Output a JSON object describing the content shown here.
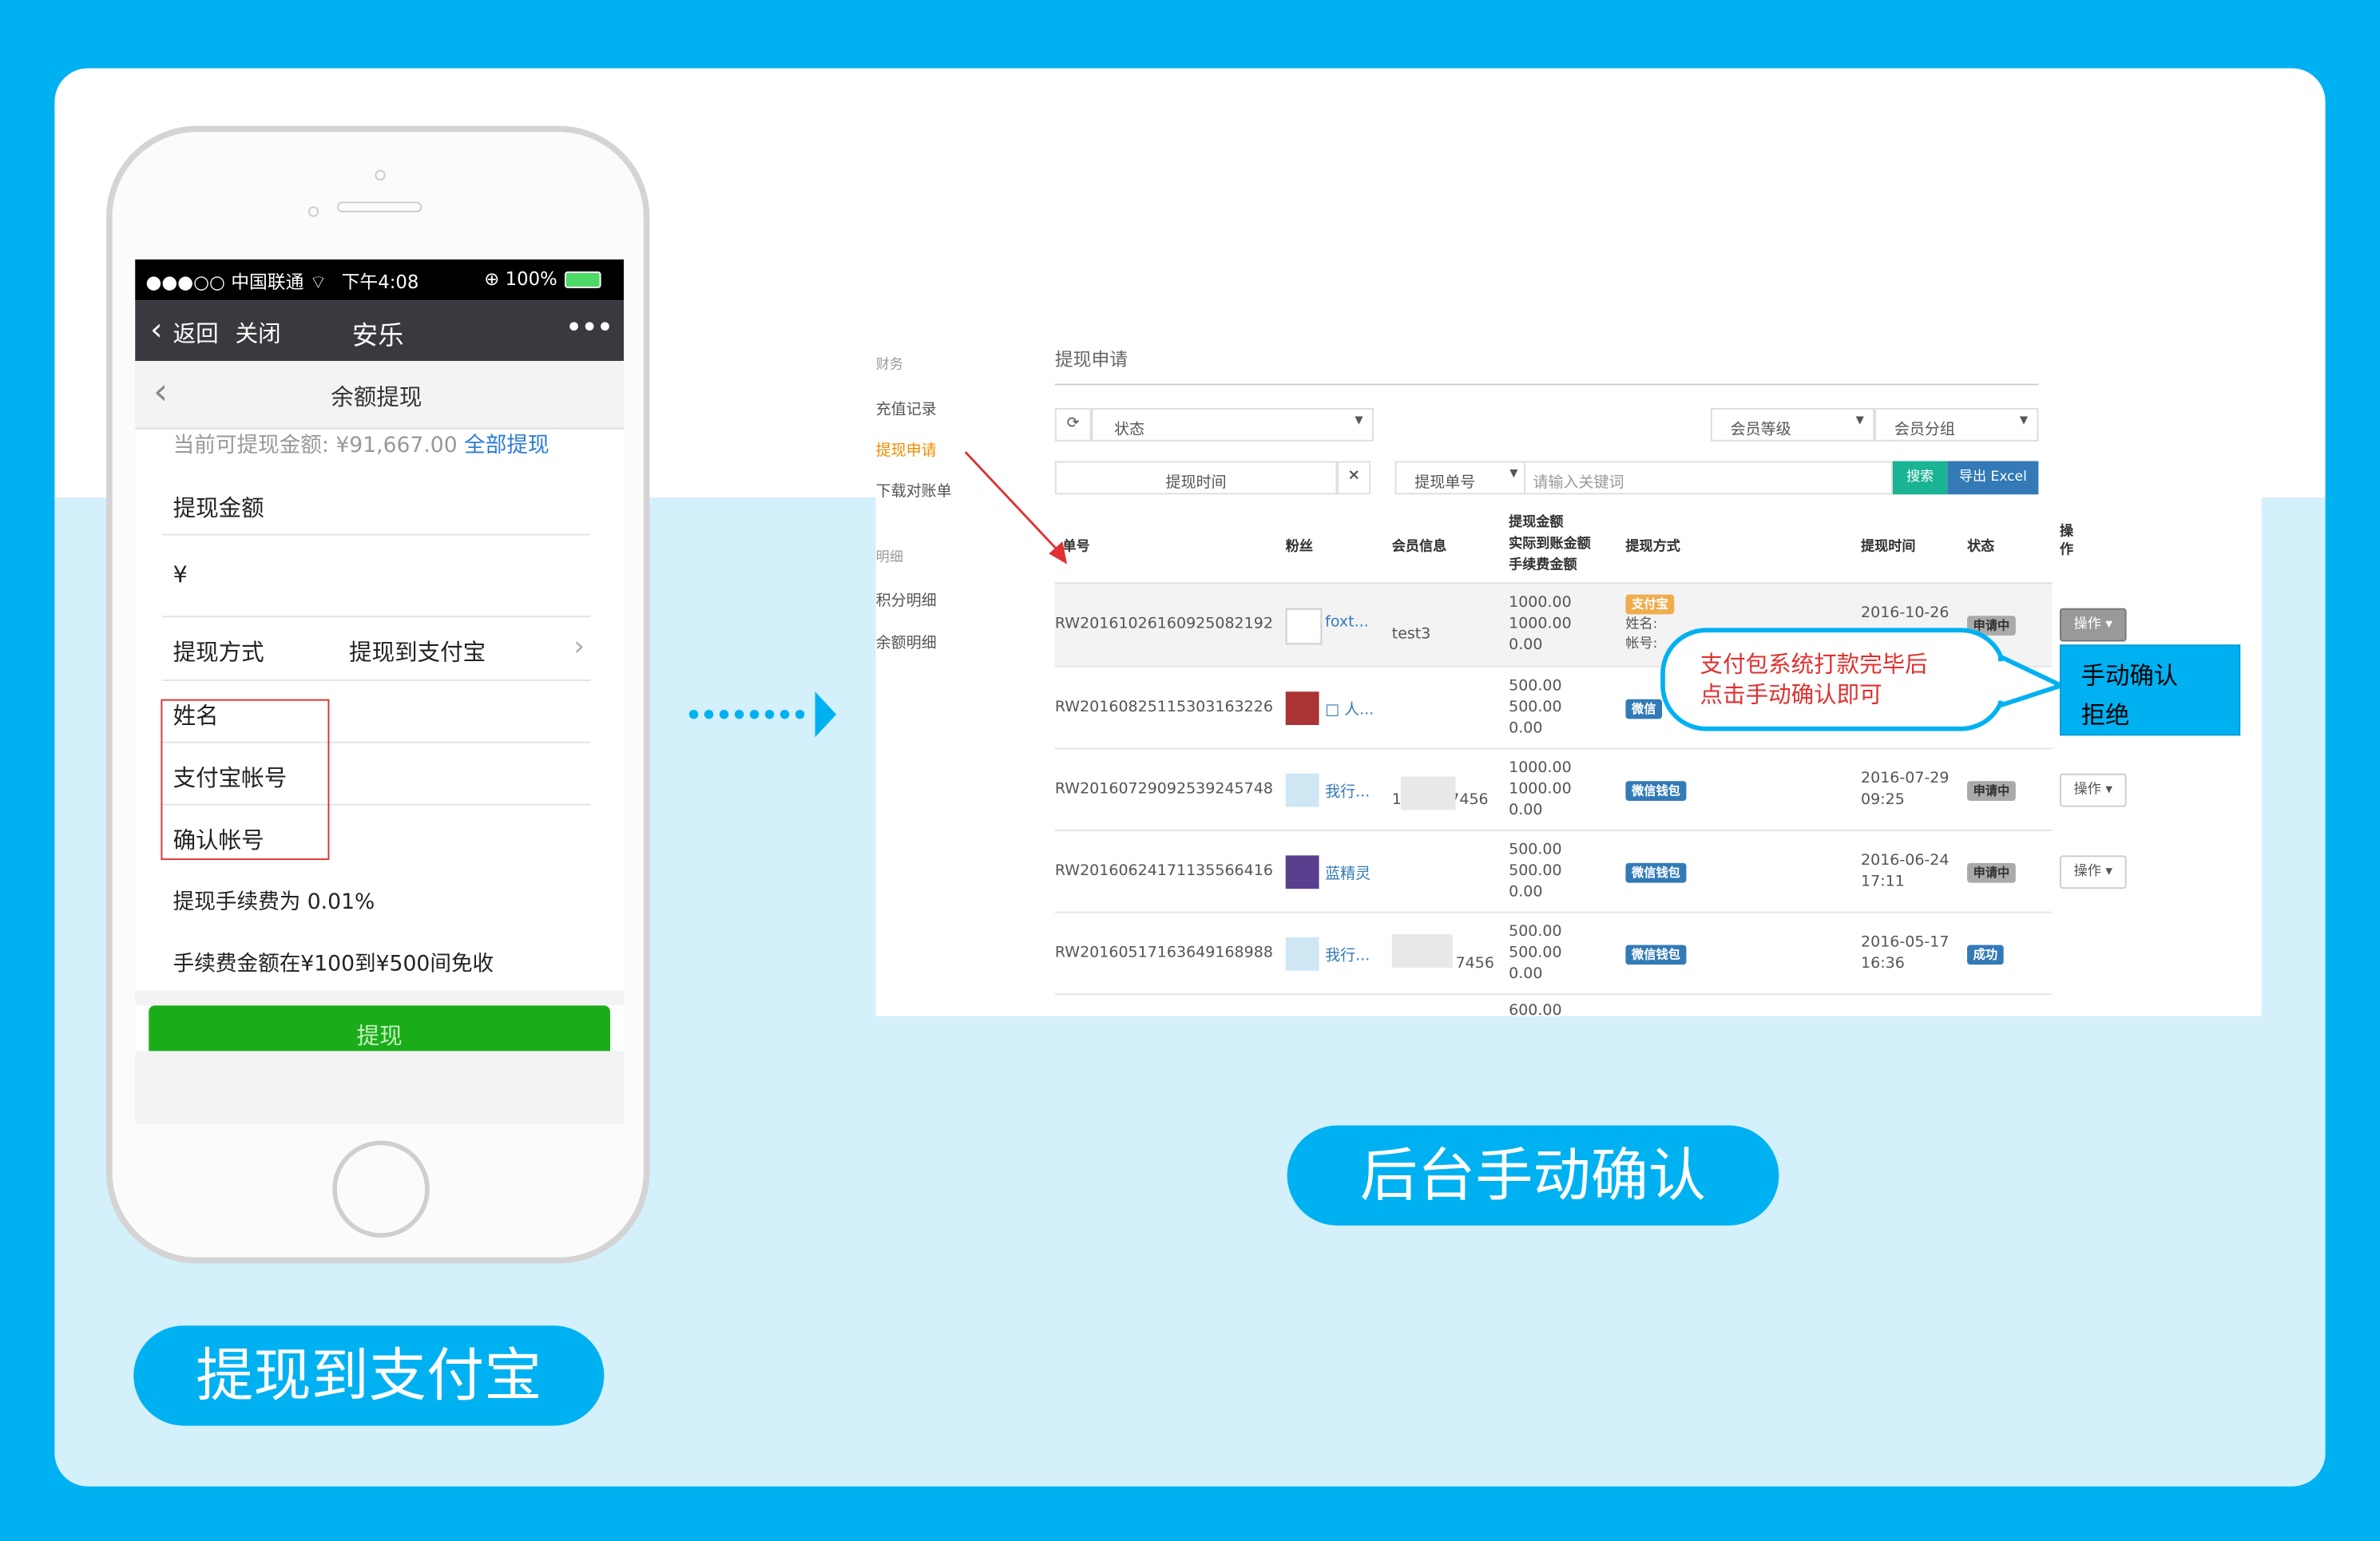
{
  "phone": {
    "status": {
      "carrier": "●●●○○ 中国联通 ⌔",
      "time": "下午4:08",
      "battery": "⊕ 100%"
    },
    "nav": {
      "back": "返回",
      "close": "关闭",
      "title": "安乐",
      "more": "•••"
    },
    "page_title": "余额提现",
    "balance_text": "当前可提现金额: ¥91,667.00",
    "withdraw_all": "全部提现",
    "amount_label": "提现金额",
    "currency": "¥",
    "method_label": "提现方式",
    "method_value": "提现到支付宝",
    "fields": [
      "姓名",
      "支付宝帐号",
      "确认帐号"
    ],
    "fee_note": "提现手续费为 0.01%",
    "fee_exempt": "手续费金额在¥100到¥500间免收",
    "submit": "提现"
  },
  "admin": {
    "sidebar": {
      "section1": "财务",
      "items1": [
        "充值记录",
        "提现申请",
        "下载对账单"
      ],
      "section2": "明细",
      "items2": [
        "积分明细",
        "余额明细"
      ]
    },
    "page_title": "提现申请",
    "filters": {
      "status": "状态",
      "member_level": "会员等级",
      "member_group": "会员分组",
      "time_placeholder": "提现时间",
      "clear": "×",
      "order_select": "提现单号",
      "keyword_placeholder": "请输入关键词",
      "search": "搜索",
      "export": "导出 Excel"
    },
    "columns": [
      "单号",
      "粉丝",
      "会员信息",
      "提现金额\n实际到账金额\n手续费金额",
      "提现方式",
      "提现时间",
      "状态",
      "操\n作"
    ],
    "rows": [
      {
        "id": "RW20161026160925082192",
        "fan": "foxt...",
        "member": "test3",
        "amounts": [
          "1000.00",
          "1000.00",
          "0.00"
        ],
        "method": "支付宝",
        "method_extra": "姓名:\n帐号:",
        "date": "2016-10-26",
        "time": "",
        "status": "申请中",
        "action": "操作"
      },
      {
        "id": "RW20160825115303163226",
        "fan": "□ 人...",
        "member": "",
        "amounts": [
          "500.00",
          "500.00",
          "0.00"
        ],
        "method": "微信",
        "method_extra": "",
        "date": "",
        "time": "",
        "status": "",
        "action": ""
      },
      {
        "id": "RW20160729092539245748",
        "fan": "我行...",
        "member": "1          7456",
        "amounts": [
          "1000.00",
          "1000.00",
          "0.00"
        ],
        "method": "微信钱包",
        "method_extra": "",
        "date": "2016-07-29",
        "time": "09:25",
        "status": "申请中",
        "action": "操作"
      },
      {
        "id": "RW20160624171135566416",
        "fan": "蓝精灵",
        "member": "",
        "amounts": [
          "500.00",
          "500.00",
          "0.00"
        ],
        "method": "微信钱包",
        "method_extra": "",
        "date": "2016-06-24",
        "time": "17:11",
        "status": "申请中",
        "action": "操作"
      },
      {
        "id": "RW20160517163649168988",
        "fan": "我行...",
        "member": "7456",
        "amounts": [
          "500.00",
          "500.00",
          "0.00"
        ],
        "method": "微信钱包",
        "method_extra": "",
        "date": "2016-05-17",
        "time": "16:36",
        "status": "成功",
        "action": ""
      }
    ],
    "partial_row_amount": "600.00",
    "callout": "支付包系统打款完毕后\n点击手动确认即可",
    "dropdown": [
      "手动确认",
      "拒绝"
    ]
  },
  "labels": {
    "left": "提现到支付宝",
    "right": "后台手动确认"
  },
  "colors": {
    "brand_blue": "#00b1f2",
    "light_blue_bg": "#d3f0fb",
    "green_button": "#1aad19",
    "alipay_orange": "#f0ad4e",
    "wechat_blue": "#337ab7",
    "search_teal": "#1ab394",
    "red_highlight": "#e03030"
  }
}
